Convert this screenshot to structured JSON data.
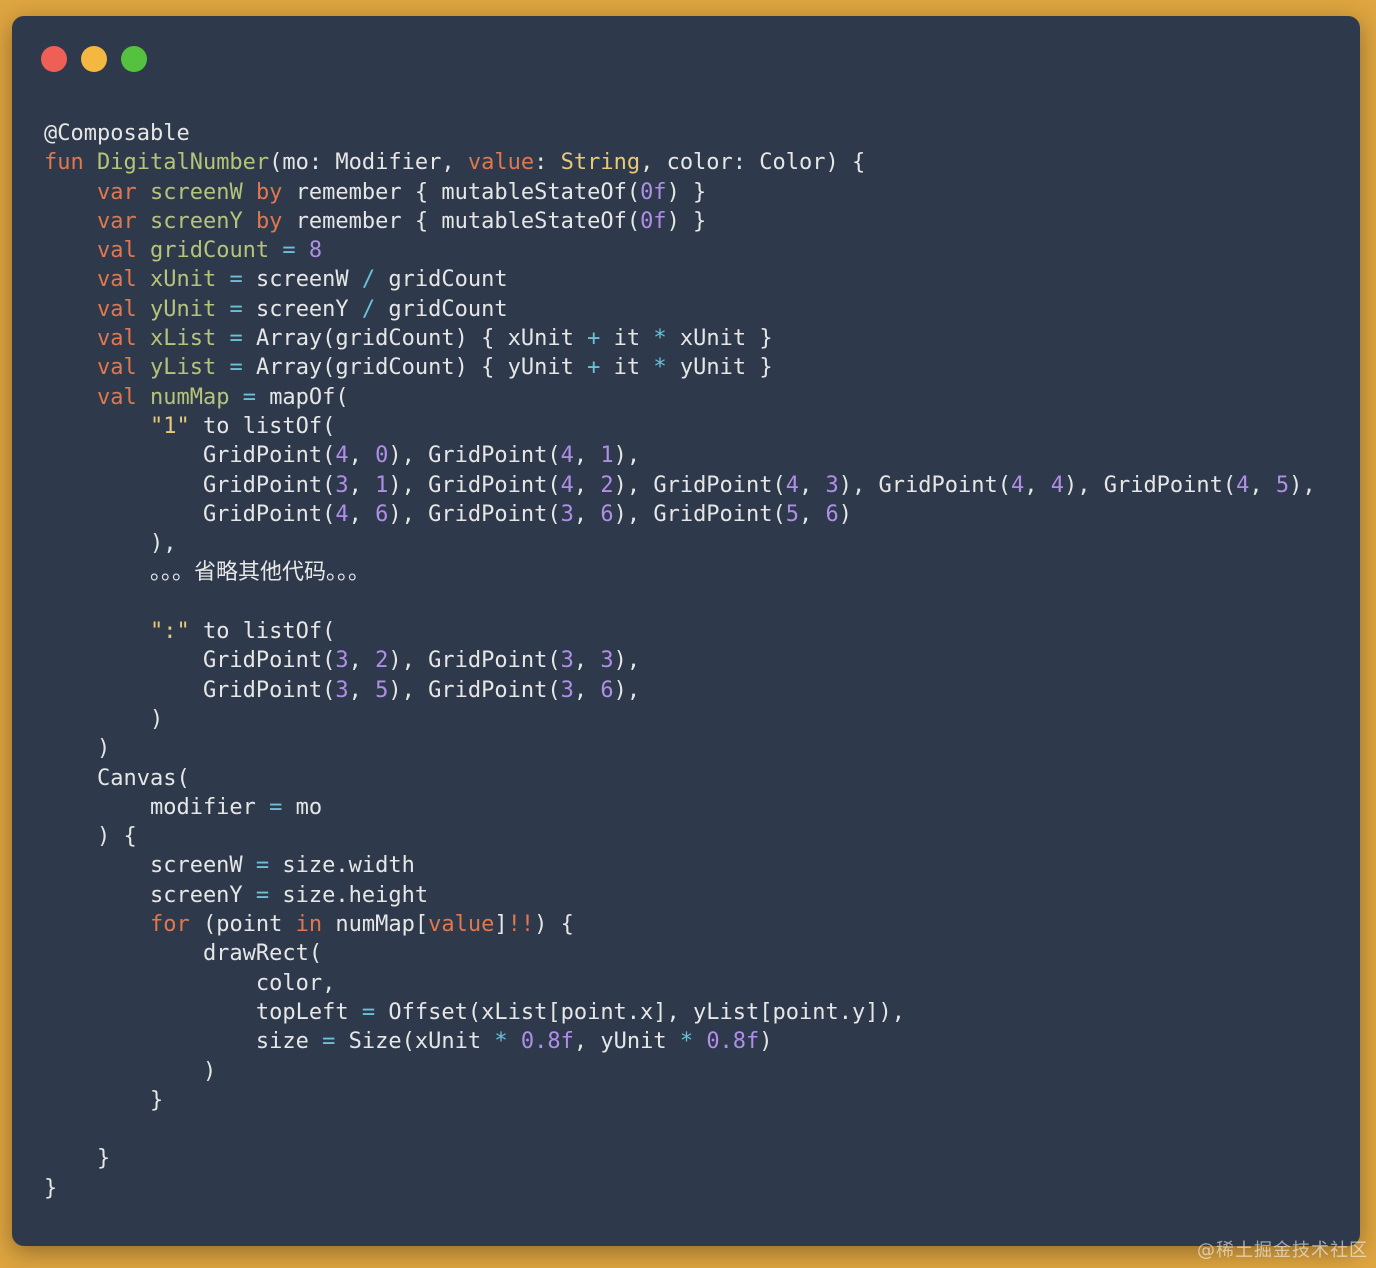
{
  "window": {
    "controls": [
      {
        "name": "close-button",
        "color": "#ee5f55"
      },
      {
        "name": "minimize-button",
        "color": "#f4b73f"
      },
      {
        "name": "zoom-button",
        "color": "#55c23f"
      }
    ]
  },
  "colors": {
    "keyword": "#e0774e",
    "declaration": "#b6c37a",
    "number": "#b08ee8",
    "string": "#e8c97a",
    "operator": "#6cc0d8",
    "text": "#e6e6e6"
  },
  "code_lines": [
    [
      [
        "id",
        "@Composable"
      ]
    ],
    [
      [
        "kw",
        "fun "
      ],
      [
        "decl",
        "DigitalNumber"
      ],
      [
        "id",
        "(mo: Modifier, "
      ],
      [
        "kw",
        "value"
      ],
      [
        "id",
        ": "
      ],
      [
        "str",
        "String"
      ],
      [
        "id",
        ", color: Color) {"
      ]
    ],
    [
      [
        "id",
        "    "
      ],
      [
        "kw",
        "var "
      ],
      [
        "decl",
        "screenW "
      ],
      [
        "kw",
        "by "
      ],
      [
        "id",
        "remember { mutableStateOf("
      ],
      [
        "num",
        "0f"
      ],
      [
        "id",
        ") }"
      ]
    ],
    [
      [
        "id",
        "    "
      ],
      [
        "kw",
        "var "
      ],
      [
        "decl",
        "screenY "
      ],
      [
        "kw",
        "by "
      ],
      [
        "id",
        "remember { mutableStateOf("
      ],
      [
        "num",
        "0f"
      ],
      [
        "id",
        ") }"
      ]
    ],
    [
      [
        "id",
        "    "
      ],
      [
        "kw",
        "val "
      ],
      [
        "decl",
        "gridCount "
      ],
      [
        "op",
        "= "
      ],
      [
        "num",
        "8"
      ]
    ],
    [
      [
        "id",
        "    "
      ],
      [
        "kw",
        "val "
      ],
      [
        "decl",
        "xUnit "
      ],
      [
        "op",
        "= "
      ],
      [
        "id",
        "screenW "
      ],
      [
        "op",
        "/ "
      ],
      [
        "id",
        "gridCount"
      ]
    ],
    [
      [
        "id",
        "    "
      ],
      [
        "kw",
        "val "
      ],
      [
        "decl",
        "yUnit "
      ],
      [
        "op",
        "= "
      ],
      [
        "id",
        "screenY "
      ],
      [
        "op",
        "/ "
      ],
      [
        "id",
        "gridCount"
      ]
    ],
    [
      [
        "id",
        "    "
      ],
      [
        "kw",
        "val "
      ],
      [
        "decl",
        "xList "
      ],
      [
        "op",
        "= "
      ],
      [
        "id",
        "Array(gridCount) { xUnit "
      ],
      [
        "op",
        "+ "
      ],
      [
        "id",
        "it "
      ],
      [
        "op",
        "* "
      ],
      [
        "id",
        "xUnit }"
      ]
    ],
    [
      [
        "id",
        "    "
      ],
      [
        "kw",
        "val "
      ],
      [
        "decl",
        "yList "
      ],
      [
        "op",
        "= "
      ],
      [
        "id",
        "Array(gridCount) { yUnit "
      ],
      [
        "op",
        "+ "
      ],
      [
        "id",
        "it "
      ],
      [
        "op",
        "* "
      ],
      [
        "id",
        "yUnit }"
      ]
    ],
    [
      [
        "id",
        "    "
      ],
      [
        "kw",
        "val "
      ],
      [
        "decl",
        "numMap "
      ],
      [
        "op",
        "= "
      ],
      [
        "id",
        "mapOf("
      ]
    ],
    [
      [
        "id",
        "        "
      ],
      [
        "str",
        "\"1\" "
      ],
      [
        "id",
        "to listOf("
      ]
    ],
    [
      [
        "id",
        "            GridPoint("
      ],
      [
        "num",
        "4"
      ],
      [
        "id",
        ", "
      ],
      [
        "num",
        "0"
      ],
      [
        "id",
        "), GridPoint("
      ],
      [
        "num",
        "4"
      ],
      [
        "id",
        ", "
      ],
      [
        "num",
        "1"
      ],
      [
        "id",
        "),"
      ]
    ],
    [
      [
        "id",
        "            GridPoint("
      ],
      [
        "num",
        "3"
      ],
      [
        "id",
        ", "
      ],
      [
        "num",
        "1"
      ],
      [
        "id",
        "), GridPoint("
      ],
      [
        "num",
        "4"
      ],
      [
        "id",
        ", "
      ],
      [
        "num",
        "2"
      ],
      [
        "id",
        "), GridPoint("
      ],
      [
        "num",
        "4"
      ],
      [
        "id",
        ", "
      ],
      [
        "num",
        "3"
      ],
      [
        "id",
        "), GridPoint("
      ],
      [
        "num",
        "4"
      ],
      [
        "id",
        ", "
      ],
      [
        "num",
        "4"
      ],
      [
        "id",
        "), GridPoint("
      ],
      [
        "num",
        "4"
      ],
      [
        "id",
        ", "
      ],
      [
        "num",
        "5"
      ],
      [
        "id",
        "),"
      ]
    ],
    [
      [
        "id",
        "            GridPoint("
      ],
      [
        "num",
        "4"
      ],
      [
        "id",
        ", "
      ],
      [
        "num",
        "6"
      ],
      [
        "id",
        "), GridPoint("
      ],
      [
        "num",
        "3"
      ],
      [
        "id",
        ", "
      ],
      [
        "num",
        "6"
      ],
      [
        "id",
        "), GridPoint("
      ],
      [
        "num",
        "5"
      ],
      [
        "id",
        ", "
      ],
      [
        "num",
        "6"
      ],
      [
        "id",
        ")"
      ]
    ],
    [
      [
        "id",
        "        ),"
      ]
    ],
    [
      [
        "id",
        "        。。。省略其他代码。。。"
      ]
    ],
    [
      [
        "id",
        ""
      ]
    ],
    [
      [
        "id",
        "        "
      ],
      [
        "str",
        "\":\" "
      ],
      [
        "id",
        "to listOf("
      ]
    ],
    [
      [
        "id",
        "            GridPoint("
      ],
      [
        "num",
        "3"
      ],
      [
        "id",
        ", "
      ],
      [
        "num",
        "2"
      ],
      [
        "id",
        "), GridPoint("
      ],
      [
        "num",
        "3"
      ],
      [
        "id",
        ", "
      ],
      [
        "num",
        "3"
      ],
      [
        "id",
        "),"
      ]
    ],
    [
      [
        "id",
        "            GridPoint("
      ],
      [
        "num",
        "3"
      ],
      [
        "id",
        ", "
      ],
      [
        "num",
        "5"
      ],
      [
        "id",
        "), GridPoint("
      ],
      [
        "num",
        "3"
      ],
      [
        "id",
        ", "
      ],
      [
        "num",
        "6"
      ],
      [
        "id",
        "),"
      ]
    ],
    [
      [
        "id",
        "        )"
      ]
    ],
    [
      [
        "id",
        "    )"
      ]
    ],
    [
      [
        "id",
        "    Canvas("
      ]
    ],
    [
      [
        "id",
        "        modifier "
      ],
      [
        "op",
        "= "
      ],
      [
        "id",
        "mo"
      ]
    ],
    [
      [
        "id",
        "    ) {"
      ]
    ],
    [
      [
        "id",
        "        screenW "
      ],
      [
        "op",
        "= "
      ],
      [
        "id",
        "size.width"
      ]
    ],
    [
      [
        "id",
        "        screenY "
      ],
      [
        "op",
        "= "
      ],
      [
        "id",
        "size.height"
      ]
    ],
    [
      [
        "id",
        "        "
      ],
      [
        "kw",
        "for "
      ],
      [
        "id",
        "(point "
      ],
      [
        "kw",
        "in "
      ],
      [
        "id",
        "numMap["
      ],
      [
        "kw",
        "value"
      ],
      [
        "id",
        "]"
      ],
      [
        "kw",
        "!!"
      ],
      [
        "id",
        ") {"
      ]
    ],
    [
      [
        "id",
        "            drawRect("
      ]
    ],
    [
      [
        "id",
        "                color,"
      ]
    ],
    [
      [
        "id",
        "                topLeft "
      ],
      [
        "op",
        "= "
      ],
      [
        "id",
        "Offset(xList[point.x], yList[point.y]),"
      ]
    ],
    [
      [
        "id",
        "                size "
      ],
      [
        "op",
        "= "
      ],
      [
        "id",
        "Size(xUnit "
      ],
      [
        "op",
        "* "
      ],
      [
        "num",
        "0.8f"
      ],
      [
        "id",
        ", yUnit "
      ],
      [
        "op",
        "* "
      ],
      [
        "num",
        "0.8f"
      ],
      [
        "id",
        ")"
      ]
    ],
    [
      [
        "id",
        "            )"
      ]
    ],
    [
      [
        "id",
        "        }"
      ]
    ],
    [
      [
        "id",
        ""
      ]
    ],
    [
      [
        "id",
        "    }"
      ]
    ],
    [
      [
        "id",
        "}"
      ]
    ]
  ],
  "watermark": "@稀土掘金技术社区"
}
